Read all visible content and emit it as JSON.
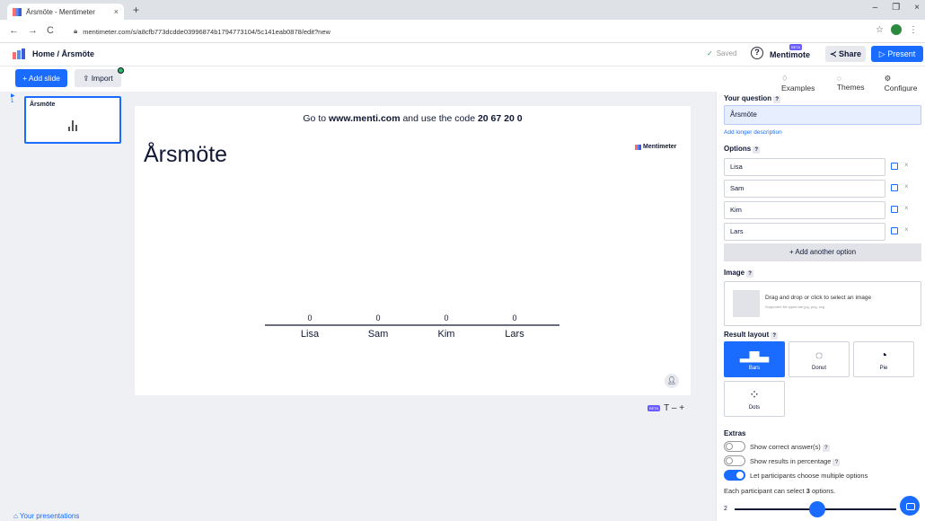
{
  "browser": {
    "tab_title": "Årsmöte - Mentimeter",
    "tab_close": "×",
    "new_tab": "+",
    "url": "mentimeter.com/s/a8cfb773dcdde03996874b1794773104/5c141eab0878/edit?new",
    "window_controls": [
      "–",
      "❐",
      "×"
    ],
    "nav": [
      "←",
      "→",
      "C"
    ]
  },
  "header": {
    "breadcrumb": "Home / Årsmöte",
    "saved": "Saved",
    "help": "?",
    "mentimote": "Mentimote",
    "beta": "BETA",
    "share": "Share",
    "present": "Present"
  },
  "toolbar": {
    "add_slide": "+ Add slide",
    "import": "Import",
    "examples": "Examples",
    "themes": "Themes",
    "configure": "Configure"
  },
  "sidebar": {
    "slide_number": "1",
    "slide_title": "Årsmöte",
    "your_presentations": "Your presentations"
  },
  "slide": {
    "instruction_prefix": "Go to ",
    "instruction_url": "www.menti.com",
    "instruction_middle": " and use the code ",
    "instruction_code": "20 67 20 0",
    "title": "Årsmöte",
    "brand": "Mentimeter",
    "beta": "BETA",
    "text_controls": "T – +"
  },
  "chart_data": {
    "type": "bar",
    "categories": [
      "Lisa",
      "Sam",
      "Kim",
      "Lars"
    ],
    "values": [
      0,
      0,
      0,
      0
    ]
  },
  "panel": {
    "question_label": "Your question",
    "question_value": "Årsmöte",
    "add_description": "Add longer description",
    "options_label": "Options",
    "options": [
      "Lisa",
      "Sam",
      "Kim",
      "Lars"
    ],
    "add_option": "+ Add another option",
    "image_label": "Image",
    "drop_text": "Drag and drop or click to select an image",
    "drop_sub": "Supported file types are jpg, png, svg",
    "result_layout_label": "Result layout",
    "layouts": [
      "Bars",
      "Donut",
      "Pie",
      "Dots"
    ],
    "extras_label": "Extras",
    "extras": [
      {
        "label": "Show correct answer(s)",
        "on": false
      },
      {
        "label": "Show results in percentage",
        "on": false
      },
      {
        "label": "Let participants choose multiple options",
        "on": true
      }
    ],
    "select_prefix": "Each participant can select ",
    "select_count": "3",
    "select_suffix": " options.",
    "slider_min": "2",
    "slider_value": 3
  },
  "colors": {
    "accent": "#196cff",
    "highlight": "#e7efff"
  }
}
